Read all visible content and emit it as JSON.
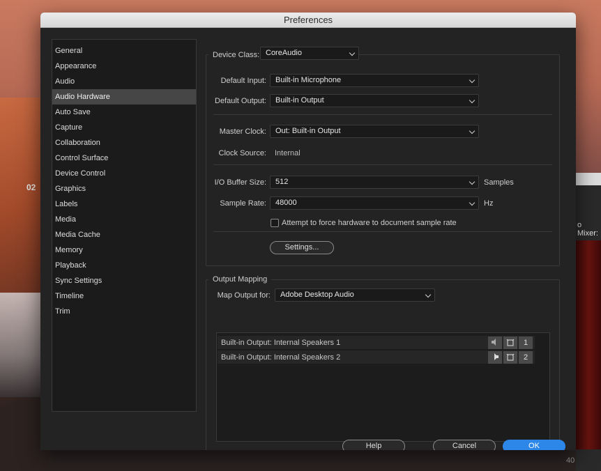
{
  "window": {
    "title": "Preferences"
  },
  "desktop": {
    "left_label": "02",
    "right_label": "o Mixer:",
    "bottom_number": "40"
  },
  "sidebar": {
    "items": [
      {
        "label": "General"
      },
      {
        "label": "Appearance"
      },
      {
        "label": "Audio"
      },
      {
        "label": "Audio Hardware",
        "active": true
      },
      {
        "label": "Auto Save"
      },
      {
        "label": "Capture"
      },
      {
        "label": "Collaboration"
      },
      {
        "label": "Control Surface"
      },
      {
        "label": "Device Control"
      },
      {
        "label": "Graphics"
      },
      {
        "label": "Labels"
      },
      {
        "label": "Media"
      },
      {
        "label": "Media Cache"
      },
      {
        "label": "Memory"
      },
      {
        "label": "Playback"
      },
      {
        "label": "Sync Settings"
      },
      {
        "label": "Timeline"
      },
      {
        "label": "Trim"
      }
    ]
  },
  "device": {
    "device_class_label": "Device Class:",
    "device_class_value": "CoreAudio",
    "default_input_label": "Default Input:",
    "default_input_value": "Built-in Microphone",
    "default_output_label": "Default Output:",
    "default_output_value": "Built-in Output",
    "master_clock_label": "Master Clock:",
    "master_clock_value": "Out: Built-in Output",
    "clock_source_label": "Clock Source:",
    "clock_source_value": "Internal",
    "buffer_label": "I/O Buffer Size:",
    "buffer_value": "512",
    "buffer_unit": "Samples",
    "sample_rate_label": "Sample Rate:",
    "sample_rate_value": "48000",
    "sample_rate_unit": "Hz",
    "force_rate_label": "Attempt to force hardware to document sample rate",
    "force_rate_checked": false,
    "settings_button": "Settings..."
  },
  "output_mapping": {
    "legend": "Output Mapping",
    "map_for_label": "Map Output for:",
    "map_for_value": "Adobe Desktop Audio",
    "rows": [
      {
        "label": "Built-in Output: Internal Speakers 1",
        "channel": "1"
      },
      {
        "label": "Built-in Output: Internal Speakers 2",
        "channel": "2"
      }
    ]
  },
  "footer": {
    "help": "Help",
    "cancel": "Cancel",
    "ok": "OK"
  },
  "colors": {
    "accent": "#2c87e8",
    "selected_row": "#464646",
    "panel_bg": "#232323"
  }
}
